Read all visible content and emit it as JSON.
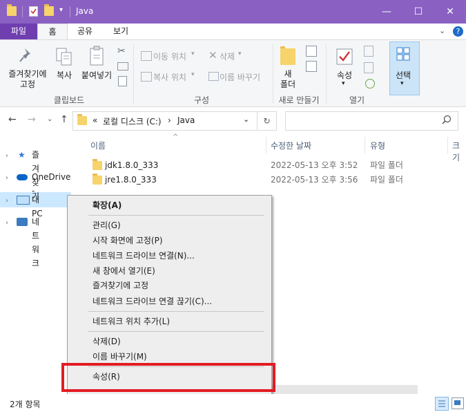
{
  "window": {
    "title": "Java",
    "min_symbol": "—",
    "max_symbol": "☐",
    "close_symbol": "✕"
  },
  "ribbon_tabs": {
    "file": "파일",
    "home": "홈",
    "share": "공유",
    "view": "보기"
  },
  "ribbon": {
    "clipboard": {
      "pin_label": "즐겨찾기에\n고정",
      "copy_label": "복사",
      "paste_label": "붙여넣기",
      "group_label": "클립보드"
    },
    "organize": {
      "move_label": "이동 위치",
      "copy_to_label": "복사 위치",
      "delete_label": "삭제",
      "rename_label": "이름 바꾸기",
      "group_label": "구성"
    },
    "new": {
      "new_folder_label": "새\n폴더",
      "group_label": "새로 만들기"
    },
    "open": {
      "properties_label": "속성",
      "group_label": "열기"
    },
    "select": {
      "select_label": "선택"
    }
  },
  "address": {
    "prefix": "«",
    "path": [
      "로컬 디스크 (C:)",
      "Java"
    ],
    "separator": "›"
  },
  "nav_pane": [
    {
      "label": "즐겨찾기",
      "icon": "star-icon"
    },
    {
      "label": "OneDrive -",
      "icon": "cloud-icon"
    },
    {
      "label": "내 PC",
      "icon": "computer-icon"
    },
    {
      "label": "네트워크",
      "icon": "network-icon"
    }
  ],
  "columns": {
    "name": "이름",
    "modified": "수정한 날짜",
    "type": "유형",
    "size": "크기"
  },
  "files": [
    {
      "name": "jdk1.8.0_333",
      "modified": "2022-05-13 오후 3:52",
      "type": "파일 폴더"
    },
    {
      "name": "jre1.8.0_333",
      "modified": "2022-05-13 오후 3:56",
      "type": "파일 폴더"
    }
  ],
  "context_menu": {
    "expand": "확장(A)",
    "manage": "관리(G)",
    "pin_start": "시작 화면에 고정(P)",
    "map_drive": "네트워크 드라이브 연결(N)...",
    "open_new_window": "새 창에서 열기(E)",
    "pin_quick": "즐겨찾기에 고정",
    "disconnect_drive": "네트워크 드라이브 연결 끊기(C)...",
    "add_network_location": "네트워크 위치 추가(L)",
    "delete": "삭제(D)",
    "rename": "이름 바꾸기(M)",
    "properties": "속성(R)"
  },
  "status": {
    "item_count": "2개 항목"
  },
  "colors": {
    "titlebar": "#8a60c2",
    "file_tab": "#6f3fb0",
    "highlight_box": "#e31b23",
    "selected_nav": "#cce8ff"
  }
}
